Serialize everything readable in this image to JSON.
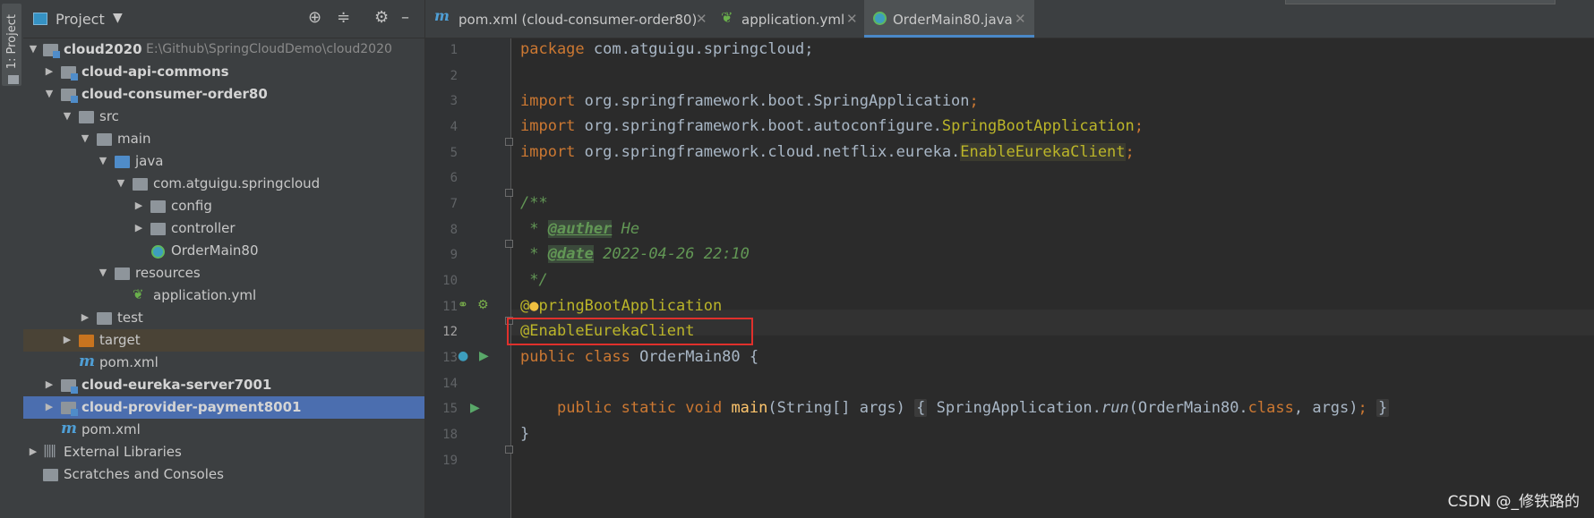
{
  "sidebar_strip": {
    "tab_label": "1: Project"
  },
  "project_panel": {
    "title": "Project",
    "tree": [
      {
        "label": "cloud2020",
        "path": "E:\\Github\\SpringCloudDemo\\cloud2020"
      },
      {
        "label": "cloud-api-commons"
      },
      {
        "label": "cloud-consumer-order80"
      },
      {
        "label": "src"
      },
      {
        "label": "main"
      },
      {
        "label": "java"
      },
      {
        "label": "com.atguigu.springcloud"
      },
      {
        "label": "config"
      },
      {
        "label": "controller"
      },
      {
        "label": "OrderMain80"
      },
      {
        "label": "resources"
      },
      {
        "label": "application.yml"
      },
      {
        "label": "test"
      },
      {
        "label": "target"
      },
      {
        "label": "pom.xml"
      },
      {
        "label": "cloud-eureka-server7001"
      },
      {
        "label": "cloud-provider-payment8001"
      },
      {
        "label": "pom.xml"
      },
      {
        "label": "External Libraries"
      },
      {
        "label": "Scratches and Consoles"
      }
    ]
  },
  "tabs": [
    {
      "label": "pom.xml (cloud-consumer-order80)",
      "icon": "maven-icon"
    },
    {
      "label": "application.yml",
      "icon": "spring-leaf-icon"
    },
    {
      "label": "OrderMain80.java",
      "icon": "spring-class-icon",
      "active": true
    }
  ],
  "editor": {
    "line_numbers": [
      "1",
      "2",
      "3",
      "4",
      "5",
      "6",
      "7",
      "8",
      "9",
      "10",
      "11",
      "12",
      "13",
      "14",
      "15",
      "18",
      "19"
    ],
    "current_line": "12",
    "code": {
      "l1_kw": "package",
      "l1_rest": " com.atguigu.springcloud;",
      "l3_kw": "import",
      "l3_rest": " org.springframework.boot.SpringApplication",
      "l3_semi": ";",
      "l4_kw": "import",
      "l4_pre": " org.springframework.boot.autoconfigure.",
      "l4_cls": "SpringBootApplication",
      "l4_semi": ";",
      "l5_kw": "import",
      "l5_pre": " org.springframework.cloud.netflix.eureka.",
      "l5_cls": "EnableEurekaClient",
      "l5_semi": ";",
      "l7": "/**",
      "l8_star": " * ",
      "l8_tag": "@auther",
      "l8_val": " He",
      "l9_star": " * ",
      "l9_tag": "@date",
      "l9_val": " 2022-04-26 22:10",
      "l10": " */",
      "l11_a": "@",
      "l11_b": "pringBootApplication",
      "l12": "@EnableEurekaClient",
      "l13_kw": "public class",
      "l13_rest": " OrderMain80 {",
      "l15_indent": "    ",
      "l15_kw": "public static void",
      "l15_sp": " ",
      "l15_fn": "main",
      "l15_args": "(String[] args)",
      "l15_ob": "{",
      "l15_body1": " SpringApplication.",
      "l15_run": "run",
      "l15_body2": "(OrderMain80.",
      "l15_class": "class",
      "l15_body3": ", args)",
      "l15_semi": ";",
      "l15_cb": "}",
      "l18": "}"
    }
  },
  "watermark": "CSDN @_修铁路的"
}
